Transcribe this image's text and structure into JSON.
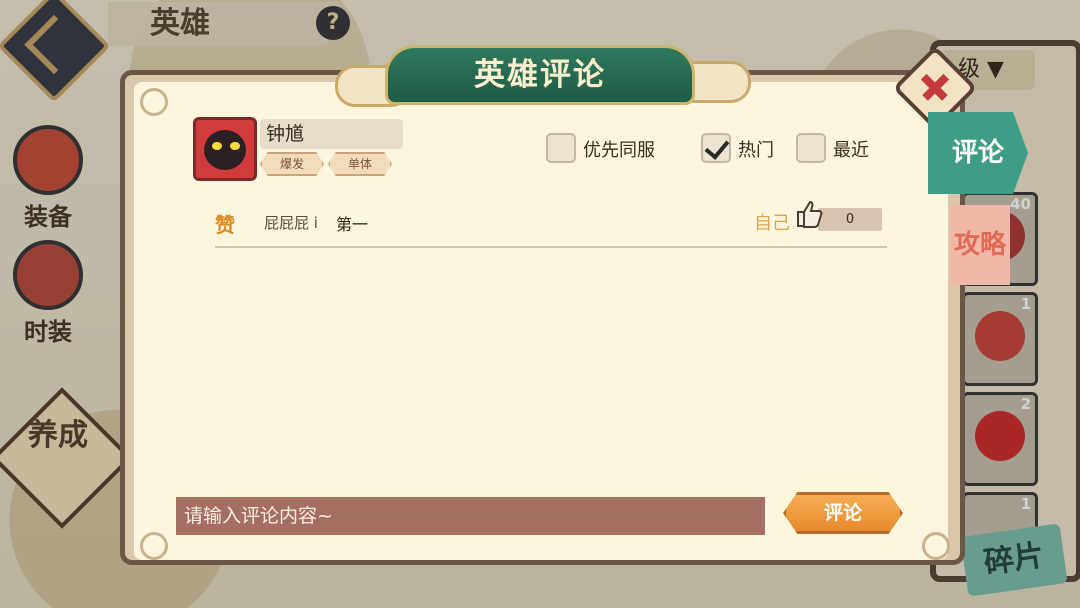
{
  "background": {
    "title": "英雄",
    "help_icon": "?",
    "side_items": [
      "装备",
      "时装"
    ],
    "cultivate": "养成",
    "level_label": "级",
    "hero_card_levels": [
      "40",
      "1",
      "2",
      "1"
    ],
    "fragment_label": "碎片"
  },
  "dialog": {
    "title": "英雄评论",
    "tabs": {
      "comment": "评论",
      "guide": "攻略"
    }
  },
  "hero": {
    "name": "钟馗",
    "tags": [
      "爆发",
      "单体"
    ]
  },
  "filters": [
    {
      "label": "优先同服",
      "checked": false
    },
    {
      "label": "热门",
      "checked": true
    },
    {
      "label": "最近",
      "checked": false
    }
  ],
  "comments": [
    {
      "badge": "赞",
      "user": "屁屁屁 i",
      "text": "第一",
      "self_label": "自己",
      "likes": "0"
    }
  ],
  "input": {
    "placeholder": "请输入评论内容~",
    "submit_label": "评论"
  },
  "colors": {
    "accent_green": "#3f9d86",
    "input_bg": "#a56e62",
    "submit_orange": "#f09a3e",
    "dialog_bg": "#fdf6df"
  }
}
